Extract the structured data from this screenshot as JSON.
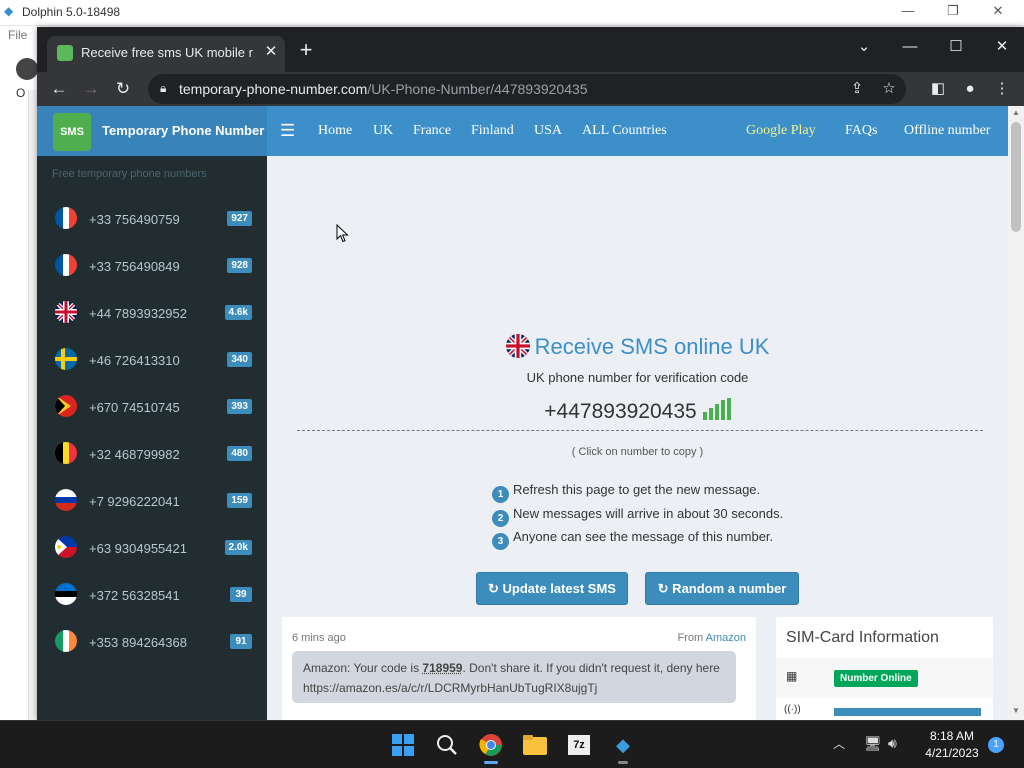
{
  "dolphin": {
    "title": "Dolphin 5.0-18498",
    "menu_file": "File",
    "partial_label": "O"
  },
  "chrome": {
    "tab_title": "Receive free sms UK mobile numb",
    "url_host": "temporary-phone-number.com",
    "url_path": "/UK-Phone-Number/447893920435"
  },
  "site": {
    "brand": "Temporary Phone Number",
    "brand_logo": "SMS",
    "nav": [
      "Home",
      "UK",
      "France",
      "Finland",
      "USA",
      "ALL Countries"
    ],
    "nav_right": [
      "Google Play",
      "FAQs",
      "Offline number"
    ],
    "sidebar_heading": "Free temporary phone numbers",
    "numbers": [
      {
        "number": "+33 756490759",
        "count": "927",
        "flag": "france"
      },
      {
        "number": "+33 756490849",
        "count": "928",
        "flag": "france"
      },
      {
        "number": "+44 7893932952",
        "count": "4.6k",
        "flag": "uk"
      },
      {
        "number": "+46 726413310",
        "count": "340",
        "flag": "sweden"
      },
      {
        "number": "+670 74510745",
        "count": "393",
        "flag": "timor-leste"
      },
      {
        "number": "+32 468799982",
        "count": "480",
        "flag": "belgium"
      },
      {
        "number": "+7 9296222041",
        "count": "159",
        "flag": "russia"
      },
      {
        "number": "+63 9304955421",
        "count": "2.0k",
        "flag": "philippines"
      },
      {
        "number": "+372 56328541",
        "count": "39",
        "flag": "estonia"
      },
      {
        "number": "+353 894264368",
        "count": "91",
        "flag": "ireland"
      }
    ],
    "hero_title": "Receive SMS online UK",
    "hero_sub": "UK phone number for verification code",
    "phone": "+447893920435",
    "copy_hint": "( Click on number to copy )",
    "steps": [
      {
        "n": "1",
        "text": "Refresh this page to get the new message."
      },
      {
        "n": "2",
        "text": "New messages will arrive in about 30 seconds."
      },
      {
        "n": "3",
        "text": "Anyone can see the message of this number."
      }
    ],
    "btn_update": "↻ Update latest SMS",
    "btn_random": "↻ Random a number",
    "message": {
      "time": "6 mins ago",
      "from_label": "From",
      "from": "Amazon",
      "text_pre": "Amazon: Your code is ",
      "code": "718959",
      "text_post": ". Don't share it. If you didn't request it, deny here https://amazon.es/a/c/r/LDCRMyrbHanUbTugRIX8ujgTj"
    },
    "sim": {
      "title": "SIM-Card Information",
      "status": "Number Online"
    }
  },
  "taskbar": {
    "time": "8:18 AM",
    "date": "4/21/2023",
    "notifications": "1"
  }
}
